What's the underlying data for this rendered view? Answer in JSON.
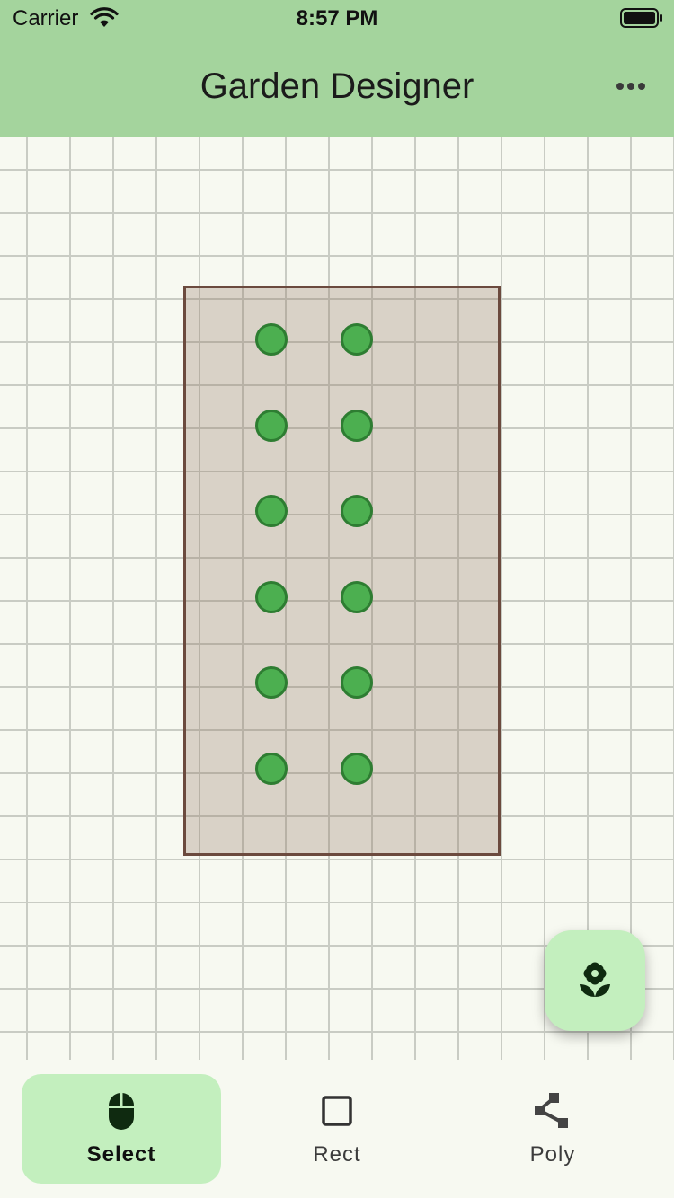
{
  "status_bar": {
    "carrier": "Carrier",
    "time": "8:57 PM"
  },
  "app_bar": {
    "title": "Garden Designer",
    "more_icon": "more-horiz-icon"
  },
  "canvas": {
    "grid": true,
    "bed": {
      "border_color": "#6b4a3e",
      "fill_color": "#d8d4cc"
    },
    "plants": {
      "rows": 6,
      "columns": 2,
      "count": 12,
      "fill_color": "#4caf50",
      "stroke_color": "#2e7d32"
    }
  },
  "fab": {
    "icon": "flower-icon",
    "background": "#c3efbe"
  },
  "bottom_nav": {
    "items": [
      {
        "label": "Select",
        "icon": "mouse-icon",
        "active": true
      },
      {
        "label": "Rect",
        "icon": "square-outline-icon",
        "active": false
      },
      {
        "label": "Poly",
        "icon": "polyline-icon",
        "active": false
      }
    ]
  },
  "colors": {
    "app_bar": "#a4d49d",
    "background": "#f7f9f1",
    "active_tab": "#c3efbe",
    "grid_line": "#c9ccc4"
  }
}
